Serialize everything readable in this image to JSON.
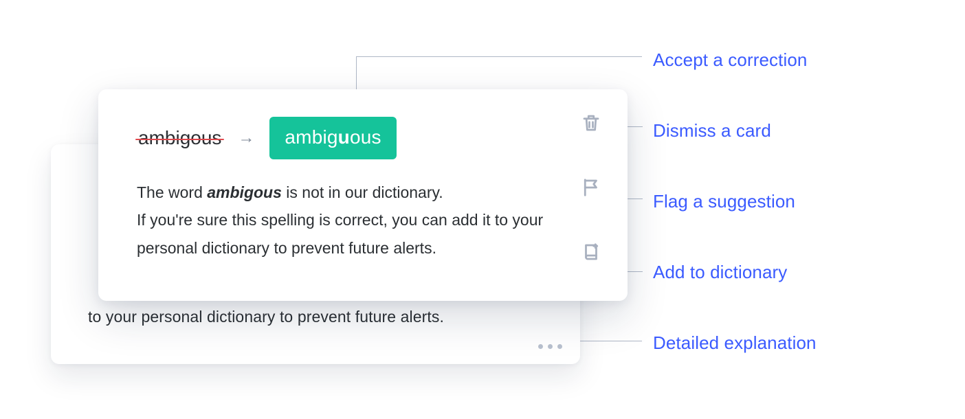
{
  "correction": {
    "original": "ambigous",
    "arrow_glyph": "→",
    "suggested_pre": "ambig",
    "suggested_mark": "u",
    "suggested_post": "ous"
  },
  "explanation": {
    "prefix": "The word ",
    "term": "ambigous",
    "line1_rest": " is not in our dictionary.",
    "line2": "If you're sure this spelling is correct, you can add it to your personal dictionary to prevent future alerts."
  },
  "back_card": {
    "peek_text": "to your personal dictionary to prevent future alerts."
  },
  "labels": {
    "accept": "Accept a correction",
    "dismiss": "Dismiss a card",
    "flag": "Flag a suggestion",
    "add": "Add to dictionary",
    "detail": "Detailed explanation"
  }
}
